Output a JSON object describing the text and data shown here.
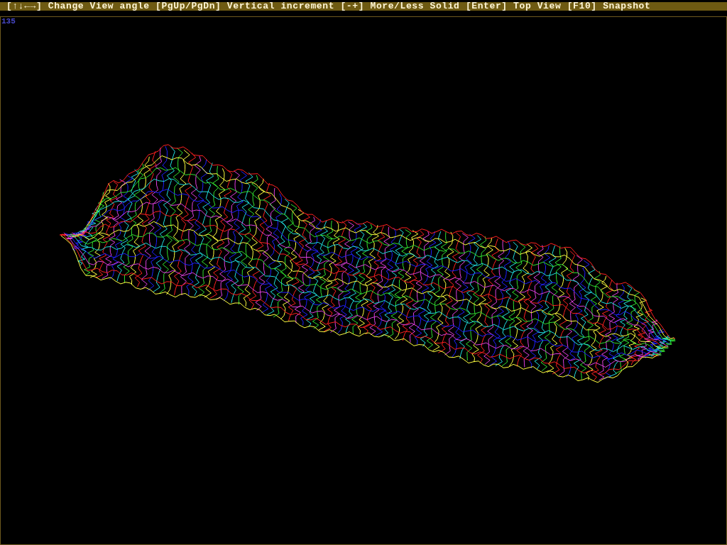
{
  "help_bar": {
    "text": "[↑↓←→] Change View angle [PgUp/PgDn] Vertical increment [-+] More/Less Solid [Enter] Top View [F10] Snapshot"
  },
  "viewport": {
    "readout": "135"
  }
}
